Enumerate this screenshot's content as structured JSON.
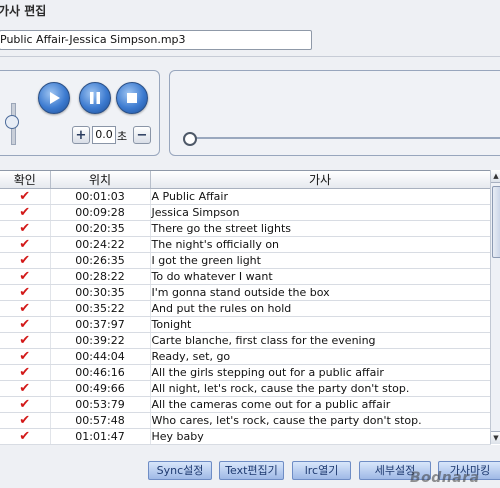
{
  "window": {
    "title": "가사 편집"
  },
  "file": {
    "name": "Public Affair-Jessica Simpson.mp3"
  },
  "player": {
    "offset_value": "0.0",
    "offset_unit": "초",
    "plus_label": "+",
    "minus_label": "−"
  },
  "table": {
    "columns": [
      "확인",
      "위치",
      "가사"
    ],
    "check_mark": "✔",
    "rows": [
      {
        "checked": true,
        "time": "00:01:03",
        "lyric": "A Public Affair"
      },
      {
        "checked": true,
        "time": "00:09:28",
        "lyric": "Jessica Simpson"
      },
      {
        "checked": true,
        "time": "00:20:35",
        "lyric": "There go the street lights"
      },
      {
        "checked": true,
        "time": "00:24:22",
        "lyric": "The night's officially on"
      },
      {
        "checked": true,
        "time": "00:26:35",
        "lyric": "I got the green light"
      },
      {
        "checked": true,
        "time": "00:28:22",
        "lyric": "To do whatever I want"
      },
      {
        "checked": true,
        "time": "00:30:35",
        "lyric": "I'm gonna stand outside the box"
      },
      {
        "checked": true,
        "time": "00:35:22",
        "lyric": "And put the rules on hold"
      },
      {
        "checked": true,
        "time": "00:37:97",
        "lyric": "Tonight"
      },
      {
        "checked": true,
        "time": "00:39:22",
        "lyric": "Carte blanche, first class for the evening"
      },
      {
        "checked": true,
        "time": "00:44:04",
        "lyric": "Ready, set, go"
      },
      {
        "checked": true,
        "time": "00:46:16",
        "lyric": "All the girls stepping out for a public affair"
      },
      {
        "checked": true,
        "time": "00:49:66",
        "lyric": "All night, let's rock, cause the party don't stop."
      },
      {
        "checked": true,
        "time": "00:53:79",
        "lyric": "All the cameras come out for a public affair"
      },
      {
        "checked": true,
        "time": "00:57:48",
        "lyric": "Who cares, let's rock, cause the party don't stop."
      },
      {
        "checked": true,
        "time": "01:01:47",
        "lyric": "Hey baby"
      }
    ]
  },
  "buttons": {
    "sync": "Sync설정",
    "text_editor": "Text편집기",
    "lrc_open": "lrc열기",
    "detail_settings": "세부설정",
    "lyrics_maker": "가사마킹"
  },
  "watermark": "Bodnara",
  "colors": {
    "check": "#d21818",
    "button_blue": "#3d7bd0"
  }
}
